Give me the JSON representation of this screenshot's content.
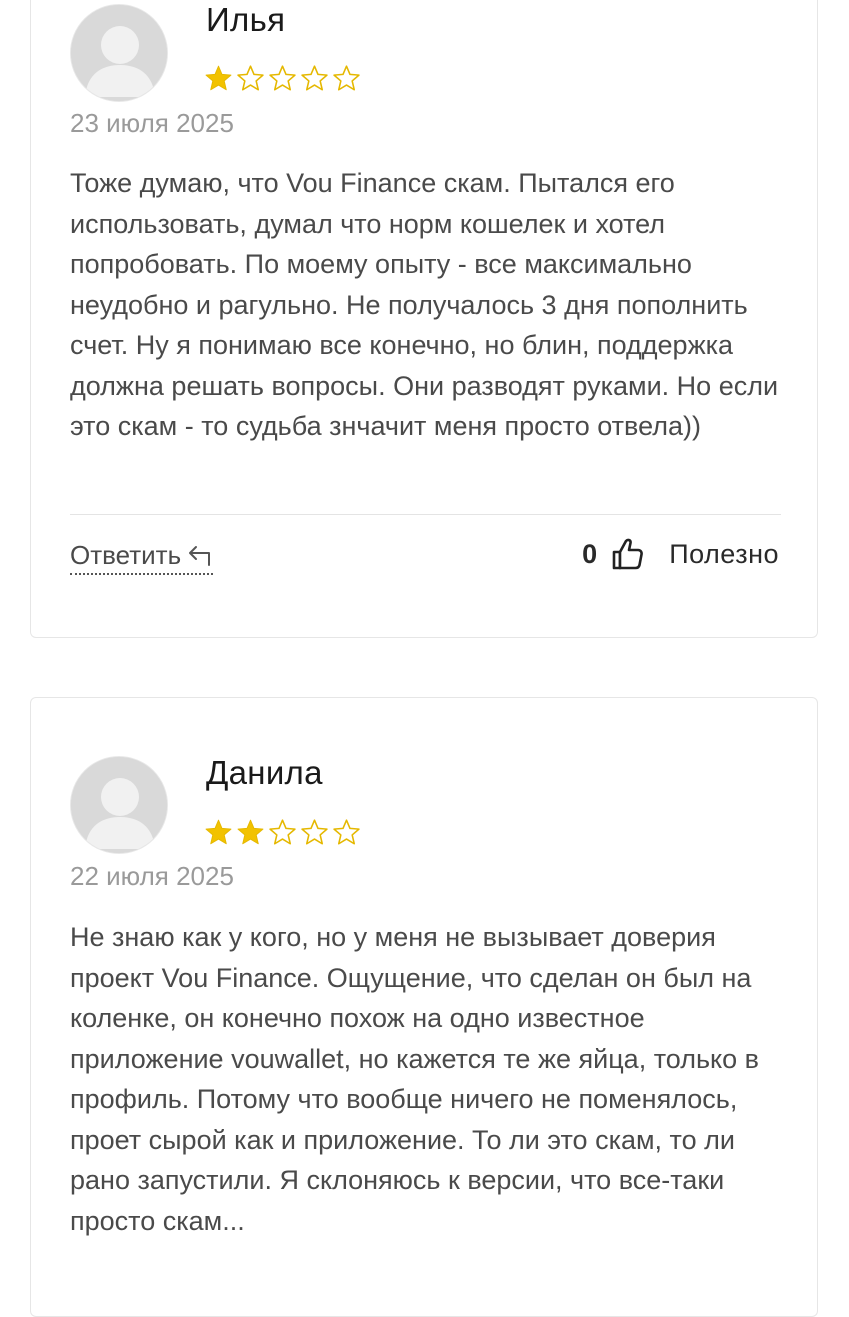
{
  "reviews": [
    {
      "name": "Илья",
      "rating": 1,
      "rating_max": 5,
      "date": "23 июля 2025",
      "text": "Тоже думаю, что Vou Finance скам. Пытался его использовать, думал что норм кошелек и хотел попробовать. По моему опыту - все максимально неудобно и рагульно. Не получалось 3 дня пополнить счет. Ну я понимаю все конечно, но блин, поддержка должна решать вопросы. Они разводят руками. Но если это скам - то судьба знчачит меня просто отвела))",
      "reply_label": "Ответить",
      "helpful_count": "0",
      "helpful_label": "Полезно"
    },
    {
      "name": "Данила",
      "rating": 2,
      "rating_max": 5,
      "date": "22 июля 2025",
      "text": "Не знаю как у кого, но у меня не вызывает доверия проект Vou Finance. Ощущение, что сделан он был на коленке, он конечно похож на одно известное приложение vouwallet, но кажется те же яйца, только в профиль. Потому что вообще ничего не поменялось, проет сырой как и приложение. То ли это скам, то ли рано запустили. Я склоняюсь к версии, что все-таки просто скам..."
    }
  ],
  "colors": {
    "star_filled": "#f2c200",
    "star_outline": "#e5b800",
    "avatar_bg": "#d9d9d9",
    "avatar_fg": "#f1f1f1",
    "date_text": "#9a9a9a",
    "body_text": "#4a4a4a"
  },
  "icons": {
    "avatar": "user-placeholder-icon",
    "star": "star-icon",
    "reply": "reply-arrow-icon",
    "thumb": "thumbs-up-icon"
  }
}
